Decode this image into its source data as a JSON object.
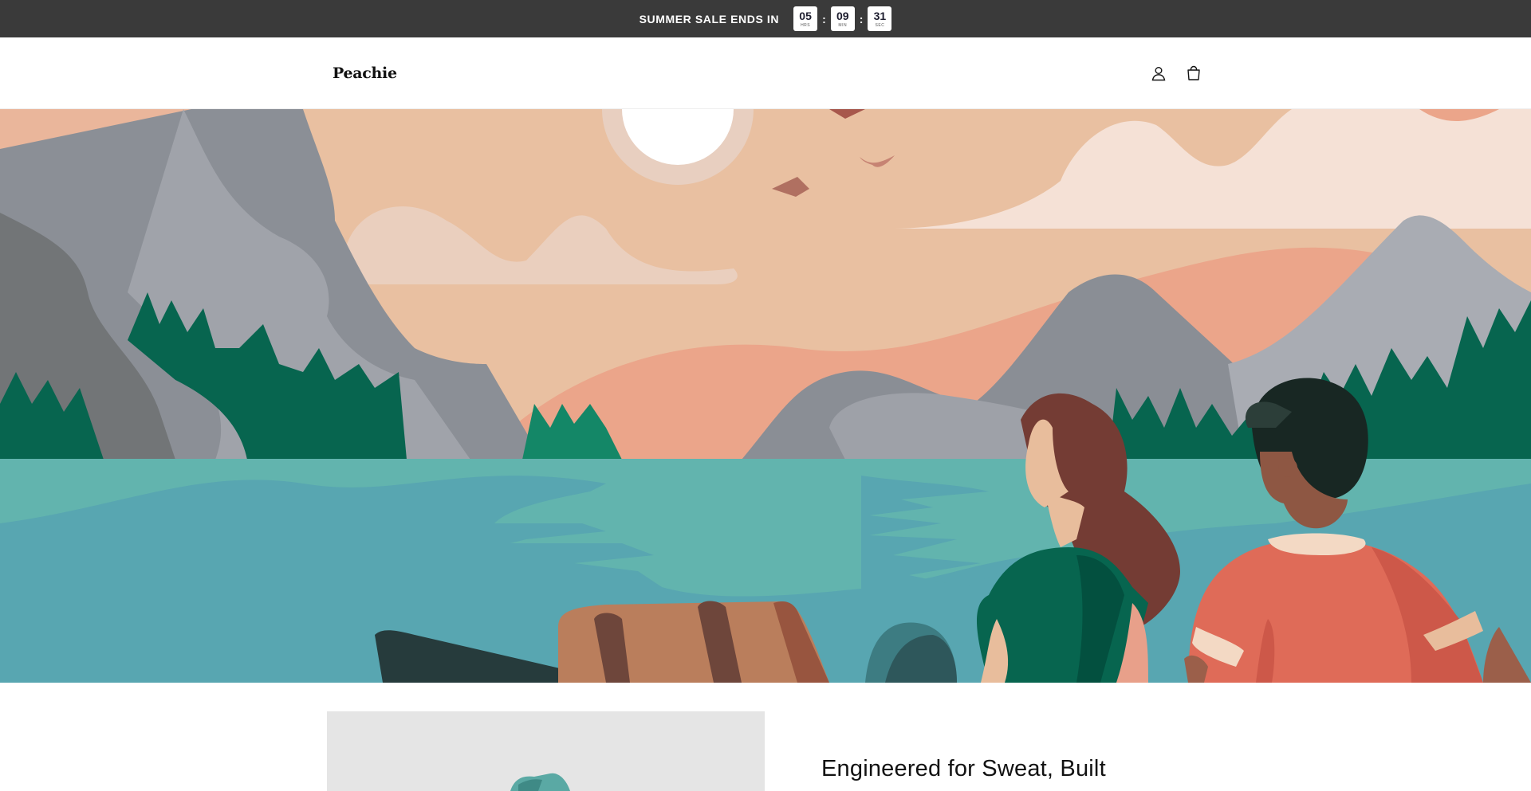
{
  "announcement": {
    "text": "SUMMER SALE ENDS IN",
    "countdown": [
      {
        "value": "05",
        "unit": "HRS"
      },
      {
        "value": "09",
        "unit": "MIN"
      },
      {
        "value": "31",
        "unit": "SEC"
      }
    ],
    "separator": ":"
  },
  "header": {
    "logo": "Peachie",
    "icons": [
      "account-icon",
      "cart-icon"
    ]
  },
  "hero": {
    "image": "illustration of two people looking at a mountain lake at sunset"
  },
  "feature": {
    "title": "Engineered for Sweat, Built"
  },
  "colors": {
    "announcement_bg": "#3a3a3a",
    "sky": "#e9bf9f",
    "water": "#5ba9b1",
    "forest": "#07654f"
  }
}
